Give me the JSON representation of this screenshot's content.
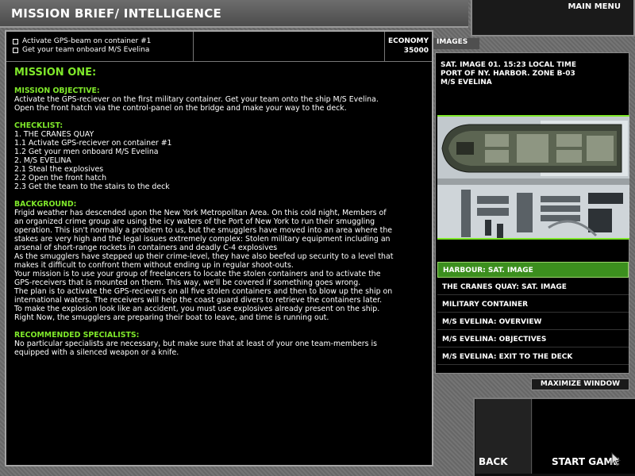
{
  "header": {
    "title": "MISSION BRIEF/ INTELLIGENCE",
    "main_menu": "MAIN MENU"
  },
  "objectives": [
    "Activate GPS-beam on container #1",
    "Get your team onboard M/S Evelina"
  ],
  "economy": {
    "label": "ECONOMY",
    "value": "35000"
  },
  "brief": {
    "mission_title": "MISSION ONE:",
    "objective_heading": "MISSION OBJECTIVE:",
    "objective_lines": [
      "Activate the GPS-reciever on the first military container. Get your team onto the ship M/S Evelina.",
      "Open the front hatch via the control-panel on the bridge and make your way to the deck."
    ],
    "checklist_heading": "CHECKLIST:",
    "checklist": [
      "1. THE CRANES QUAY",
      "1.1 Activate GPS-reciever on container #1",
      "1.2 Get your men onboard M/S Evelina",
      "2. M/S EVELINA",
      "2.1 Steal the explosives",
      "2.2 Open the front hatch",
      "2.3 Get the team to the stairs to the deck"
    ],
    "background_heading": "BACKGROUND:",
    "background_lines": [
      "Frigid weather has descended upon the New York Metropolitan Area. On this cold night, Members of",
      "an organized crime group are using the icy waters of the Port of New York to run their smuggling",
      "operation. This isn't normally a problem to us, but the smugglers have moved into an area where the",
      "stakes are very high and the legal issues extremely complex: Stolen military equipment including an",
      "arsenal of short-range rockets in containers and deadly C-4 explosives",
      "As the smugglers have stepped up their crime-level, they have also beefed up security to a level that",
      "makes it difficult to confront them without ending up in regular shoot-outs.",
      "Your mission is to use your group of freelancers to locate the stolen containers and to activate the",
      "GPS-receivers that is mounted on them. This way, we'll be covered if something goes wrong.",
      "The plan is to activate the GPS-recievers on all five stolen containers and then to blow up the ship on",
      "international waters. The receivers will help the coast guard divers to retrieve the containers later.",
      "To make the explosion look like an accident, you must use explosives already present on the ship.",
      "Right Now, the smugglers are preparing their boat to leave, and time is running out."
    ],
    "specialists_heading": "RECOMMENDED SPECIALISTS:",
    "specialists_lines": [
      "No particular specialists are necessary, but make sure that at least of your one team-members is",
      "equipped with a silenced weapon or a knife."
    ]
  },
  "images": {
    "tab_label": "IMAGES",
    "caption_lines": [
      "SAT. IMAGE 01. 15:23 LOCAL TIME",
      "PORT OF NY. HARBOR. ZONE B-03",
      "M/S EVELINA"
    ],
    "items": [
      {
        "label": "HARBOUR: SAT. IMAGE",
        "active": true
      },
      {
        "label": "THE CRANES QUAY: SAT. IMAGE",
        "active": false
      },
      {
        "label": "MILITARY CONTAINER",
        "active": false
      },
      {
        "label": "M/S EVELINA: OVERVIEW",
        "active": false
      },
      {
        "label": "M/S EVELINA: OBJECTIVES",
        "active": false
      },
      {
        "label": "M/S EVELINA: EXIT TO THE DECK",
        "active": false
      }
    ],
    "maximize_label": "MAXIMIZE WINDOW"
  },
  "footer": {
    "back_label": "BACK",
    "start_label": "START GAME"
  },
  "colors": {
    "accent_green": "#7fe82a",
    "active_item": "#3c8f1e"
  }
}
